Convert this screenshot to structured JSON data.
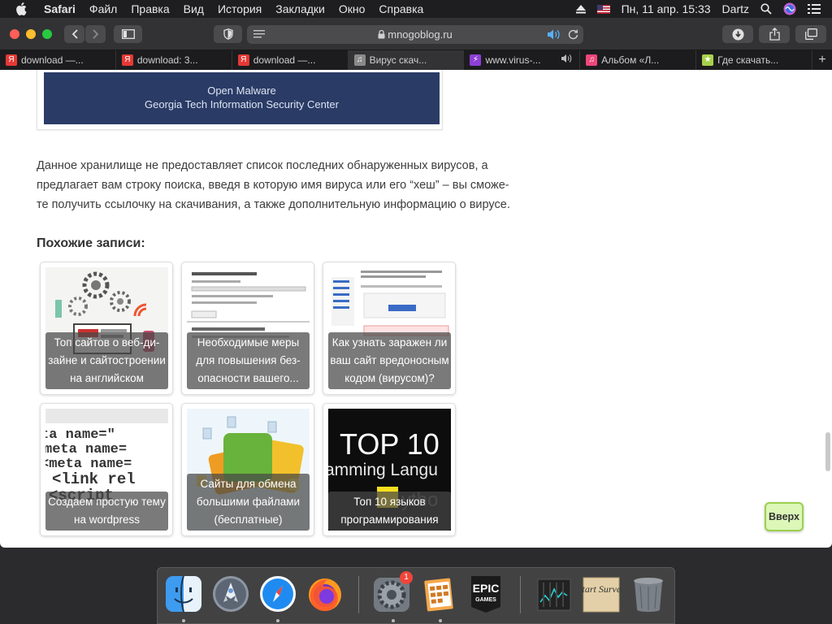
{
  "menubar": {
    "app": "Safari",
    "items": [
      "Файл",
      "Правка",
      "Вид",
      "История",
      "Закладки",
      "Окно",
      "Справка"
    ],
    "datetime": "Пн, 11 апр.  15:33",
    "user": "Dartz"
  },
  "toolbar": {
    "url": "mnogoblog.ru"
  },
  "tabs": [
    {
      "label": "download —...",
      "fav_color": "#e53935",
      "fav_char": "Я"
    },
    {
      "label": "download: 3...",
      "fav_color": "#e53935",
      "fav_char": "Я"
    },
    {
      "label": "download —...",
      "fav_color": "#e53935",
      "fav_char": "Я"
    },
    {
      "label": "Вирус скач...",
      "fav_color": "#8a8a8a",
      "fav_char": "♫",
      "active": true
    },
    {
      "label": "www.virus-...",
      "fav_color": "#8e3fd6",
      "fav_char": "⚡",
      "audio": true
    },
    {
      "label": "Альбом «Л...",
      "fav_color": "#f0467a",
      "fav_char": "♫"
    },
    {
      "label": "Где скачать...",
      "fav_color": "#a6d14a",
      "fav_char": "★"
    }
  ],
  "page": {
    "malware_banner": {
      "line1": "Open Malware",
      "line2": "Georgia Tech Information Security Center"
    },
    "paragraph": [
      "Данное хранилище не предоставляет список последних обнаруженных вирусов, а",
      "предлагает вам строку поиска, введя в которую имя вируса или его “хеш” – вы сможе-",
      "те получить ссылочку на скачивания, а также дополнительную информацию о вирусе."
    ],
    "related_title": "Похожие записи:",
    "related": [
      {
        "caption": [
          "Топ сайтов о веб-ди-",
          "зайне и сайтостроении",
          "на английском"
        ],
        "thumb": "web-design"
      },
      {
        "caption": [
          "Необходимые меры",
          "для повышения без-",
          "опасности вашего..."
        ],
        "thumb": "document"
      },
      {
        "caption": [
          "Как узнать заражен ли",
          "ваш сайт вредоносным",
          "кодом (вирусом)?"
        ],
        "thumb": "screenshot"
      },
      {
        "caption": [
          "Создаем простую тему",
          "на wordpress"
        ],
        "thumb": "code"
      },
      {
        "caption": [
          "Сайты для обмена",
          "большими файлами",
          "(бесплатные)"
        ],
        "thumb": "files"
      },
      {
        "caption": [
          "Топ 10 языков",
          "программирования"
        ],
        "thumb": "top10",
        "thumb_text1": "TOP 10",
        "thumb_text2": "amming Langu"
      }
    ],
    "up_button": "Вверх"
  },
  "dock": {
    "badge": "1",
    "epic_line1": "EPIC",
    "epic_line2": "GAMES",
    "start_survey": "Start Survey"
  }
}
